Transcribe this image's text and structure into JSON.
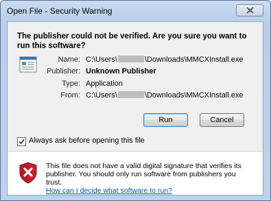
{
  "window": {
    "title": "Open File - Security Warning"
  },
  "headline": "The publisher could not be verified.  Are you sure you want to run this software?",
  "fields": {
    "name_label": "Name:",
    "name_prefix": "C:\\Users\\",
    "name_suffix": "\\Downloads\\MMCXInstall.exe",
    "publisher_label": "Publisher:",
    "publisher_value": "Unknown Publisher",
    "type_label": "Type:",
    "type_value": "Application",
    "from_label": "From:",
    "from_prefix": "C:\\Users\\",
    "from_suffix": "\\Downloads\\MMCXInstall.exe"
  },
  "buttons": {
    "run": "Run",
    "cancel": "Cancel"
  },
  "checkbox": {
    "label": "Always ask before opening this file",
    "checked": true
  },
  "footer": {
    "message": "This file does not have a valid digital signature that verifies its publisher.  You should only run software from publishers you trust.",
    "link": "How can I decide what software to run?"
  },
  "icons": {
    "close": "close-icon",
    "file": "application-file-icon",
    "shield": "security-warning-shield-icon",
    "check": "checkmark-icon"
  }
}
